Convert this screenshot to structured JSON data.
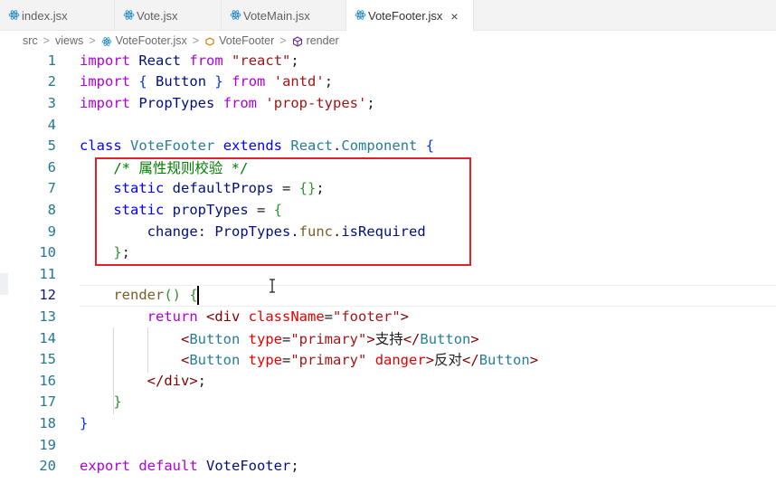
{
  "tabs": [
    {
      "label": "index.jsx",
      "active": false,
      "icon": "react-icon"
    },
    {
      "label": "Vote.jsx",
      "active": false,
      "icon": "react-icon"
    },
    {
      "label": "VoteMain.jsx",
      "active": false,
      "icon": "react-icon"
    },
    {
      "label": "VoteFooter.jsx",
      "active": true,
      "icon": "react-icon",
      "close": "×"
    }
  ],
  "breadcrumb": {
    "parts": [
      "src",
      "views",
      "VoteFooter.jsx",
      "VoteFooter",
      "render"
    ],
    "separator": ">"
  },
  "lines": [
    [
      [
        "kw2",
        "import"
      ],
      [
        "p",
        " "
      ],
      [
        "var",
        "React"
      ],
      [
        "p",
        " "
      ],
      [
        "kw2",
        "from"
      ],
      [
        "p",
        " "
      ],
      [
        "str",
        "\"react\""
      ],
      [
        "p",
        ";"
      ]
    ],
    [
      [
        "kw2",
        "import"
      ],
      [
        "p",
        " "
      ],
      [
        "b1",
        "{"
      ],
      [
        "p",
        " "
      ],
      [
        "var",
        "Button"
      ],
      [
        "p",
        " "
      ],
      [
        "b1",
        "}"
      ],
      [
        "p",
        " "
      ],
      [
        "kw2",
        "from"
      ],
      [
        "p",
        " "
      ],
      [
        "str",
        "'antd'"
      ],
      [
        "p",
        ";"
      ]
    ],
    [
      [
        "kw2",
        "import"
      ],
      [
        "p",
        " "
      ],
      [
        "var",
        "PropTypes"
      ],
      [
        "p",
        " "
      ],
      [
        "kw2",
        "from"
      ],
      [
        "p",
        " "
      ],
      [
        "str",
        "'prop-types'"
      ],
      [
        "p",
        ";"
      ]
    ],
    [],
    [
      [
        "kw",
        "class"
      ],
      [
        "p",
        " "
      ],
      [
        "cls",
        "VoteFooter"
      ],
      [
        "p",
        " "
      ],
      [
        "kw",
        "extends"
      ],
      [
        "p",
        " "
      ],
      [
        "cls",
        "React"
      ],
      [
        "p",
        "."
      ],
      [
        "cls",
        "Component"
      ],
      [
        "p",
        " "
      ],
      [
        "b1",
        "{"
      ]
    ],
    [
      [
        "p",
        "    "
      ],
      [
        "cmt",
        "/* 属性规则校验 */"
      ]
    ],
    [
      [
        "p",
        "    "
      ],
      [
        "kw",
        "static"
      ],
      [
        "p",
        " "
      ],
      [
        "var",
        "defaultProps"
      ],
      [
        "p",
        " = "
      ],
      [
        "b2",
        "{}"
      ],
      [
        "p",
        ";"
      ]
    ],
    [
      [
        "p",
        "    "
      ],
      [
        "kw",
        "static"
      ],
      [
        "p",
        " "
      ],
      [
        "var",
        "propTypes"
      ],
      [
        "p",
        " = "
      ],
      [
        "b2",
        "{"
      ]
    ],
    [
      [
        "p",
        "        "
      ],
      [
        "var",
        "change"
      ],
      [
        "p",
        ": "
      ],
      [
        "var",
        "PropTypes"
      ],
      [
        "p",
        "."
      ],
      [
        "fn",
        "func"
      ],
      [
        "p",
        "."
      ],
      [
        "var",
        "isRequired"
      ]
    ],
    [
      [
        "p",
        "    "
      ],
      [
        "b2",
        "}"
      ],
      [
        "p",
        ";"
      ]
    ],
    [],
    [
      [
        "p",
        "    "
      ],
      [
        "fn",
        "render"
      ],
      [
        "b2",
        "()"
      ],
      [
        "p",
        " "
      ],
      [
        "b2",
        "{"
      ]
    ],
    [
      [
        "p",
        "        "
      ],
      [
        "kw2",
        "return"
      ],
      [
        "p",
        " "
      ],
      [
        "tag",
        "<div"
      ],
      [
        "p",
        " "
      ],
      [
        "attr",
        "className"
      ],
      [
        "p",
        "="
      ],
      [
        "str",
        "\"footer\""
      ],
      [
        "tag",
        ">"
      ]
    ],
    [
      [
        "p",
        "            "
      ],
      [
        "tag",
        "<"
      ],
      [
        "attr2",
        "Button"
      ],
      [
        "p",
        " "
      ],
      [
        "attr",
        "type"
      ],
      [
        "p",
        "="
      ],
      [
        "str",
        "\"primary\""
      ],
      [
        "tag",
        ">"
      ],
      [
        "p",
        "支持"
      ],
      [
        "tag",
        "</"
      ],
      [
        "attr2",
        "Button"
      ],
      [
        "tag",
        ">"
      ]
    ],
    [
      [
        "p",
        "            "
      ],
      [
        "tag",
        "<"
      ],
      [
        "attr2",
        "Button"
      ],
      [
        "p",
        " "
      ],
      [
        "attr",
        "type"
      ],
      [
        "p",
        "="
      ],
      [
        "str",
        "\"primary\""
      ],
      [
        "p",
        " "
      ],
      [
        "attr",
        "danger"
      ],
      [
        "tag",
        ">"
      ],
      [
        "p",
        "反对"
      ],
      [
        "tag",
        "</"
      ],
      [
        "attr2",
        "Button"
      ],
      [
        "tag",
        ">"
      ]
    ],
    [
      [
        "p",
        "        "
      ],
      [
        "tag",
        "</div>"
      ],
      [
        "p",
        ";"
      ]
    ],
    [
      [
        "p",
        "    "
      ],
      [
        "b2",
        "}"
      ]
    ],
    [
      [
        "b1",
        "}"
      ]
    ],
    [],
    [
      [
        "kw2",
        "export"
      ],
      [
        "p",
        " "
      ],
      [
        "kw2",
        "default"
      ],
      [
        "p",
        " "
      ],
      [
        "var",
        "VoteFooter"
      ],
      [
        "p",
        ";"
      ]
    ]
  ],
  "line_numbers": [
    "1",
    "2",
    "3",
    "4",
    "5",
    "6",
    "7",
    "8",
    "9",
    "10",
    "11",
    "12",
    "13",
    "14",
    "15",
    "16",
    "17",
    "18",
    "19",
    "20"
  ],
  "active_line": 12,
  "colors": {
    "highlight_box": "#e0202a",
    "line_number": "#237893",
    "react_icon": "#1a85c8"
  }
}
